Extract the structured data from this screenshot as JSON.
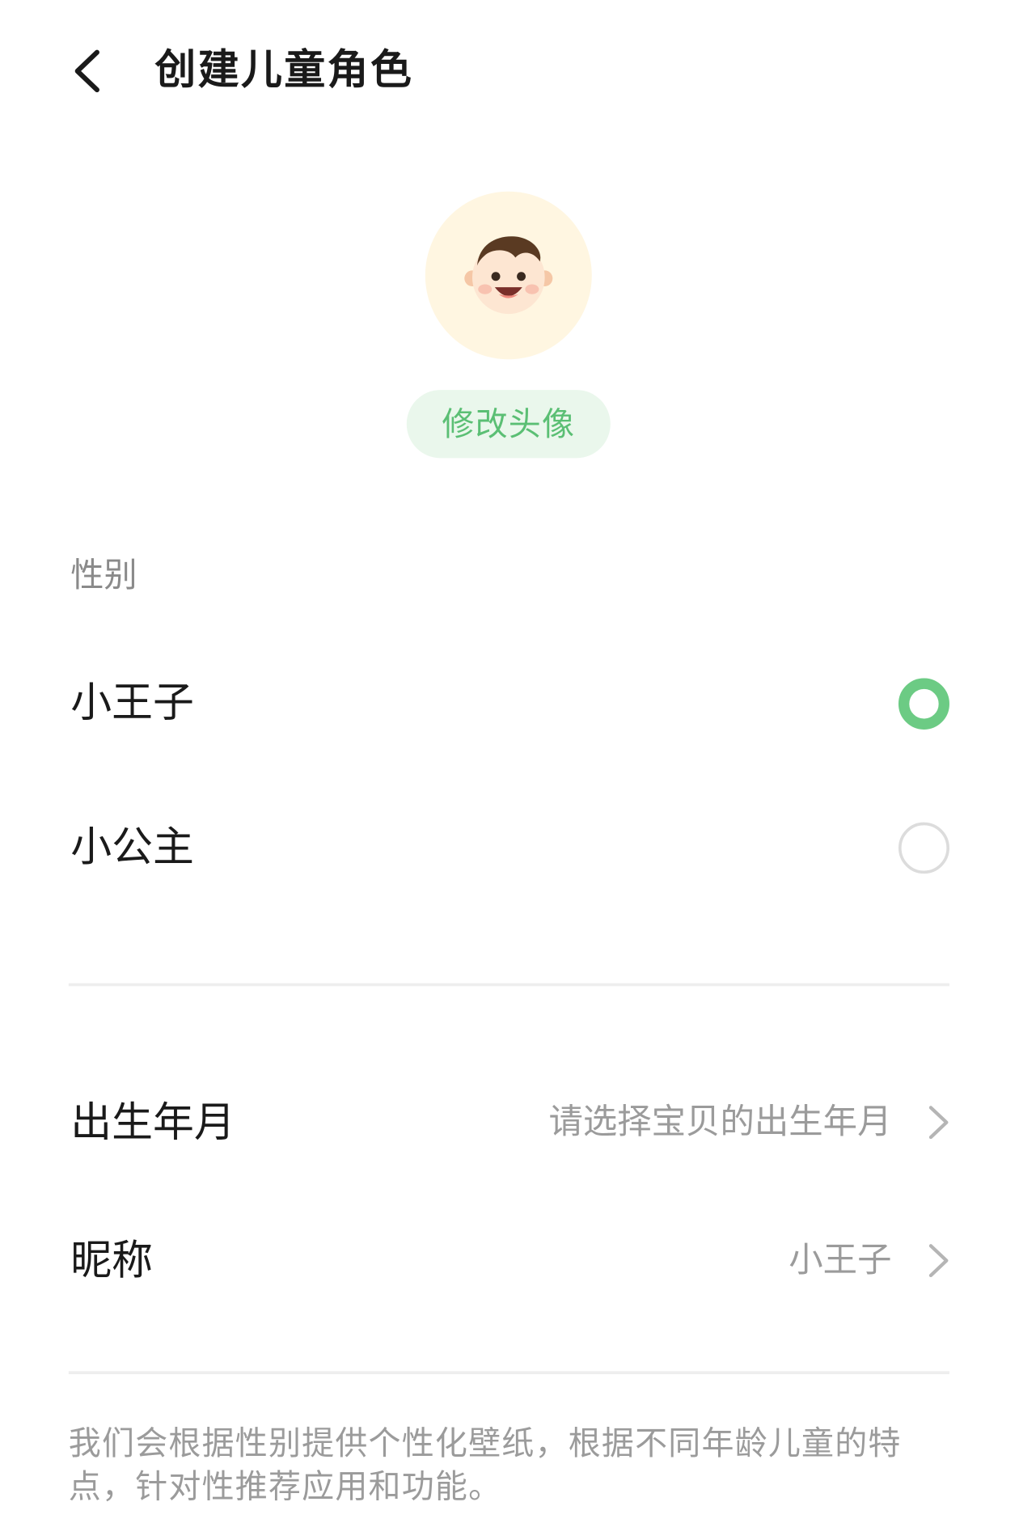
{
  "header": {
    "title": "创建儿童角色",
    "back_icon": "back-arrow-icon"
  },
  "avatar": {
    "icon": "baby-face-icon",
    "edit_label": "修改头像"
  },
  "gender": {
    "section_label": "性别",
    "options": [
      {
        "label": "小王子",
        "selected": true
      },
      {
        "label": "小公主",
        "selected": false
      }
    ]
  },
  "birth": {
    "label": "出生年月",
    "placeholder": "请选择宝贝的出生年月"
  },
  "nickname": {
    "label": "昵称",
    "value": "小王子"
  },
  "footnote": "我们会根据性别提供个性化壁纸，根据不同年龄儿童的特点，针对性推荐应用和功能。",
  "colors": {
    "accent": "#6ccb84",
    "accent_text": "#5bbf74",
    "accent_bg": "#eaf7ec",
    "avatar_bg": "#fff6e1",
    "text_primary": "#1a1a1a",
    "text_secondary": "#9b9b9b"
  }
}
